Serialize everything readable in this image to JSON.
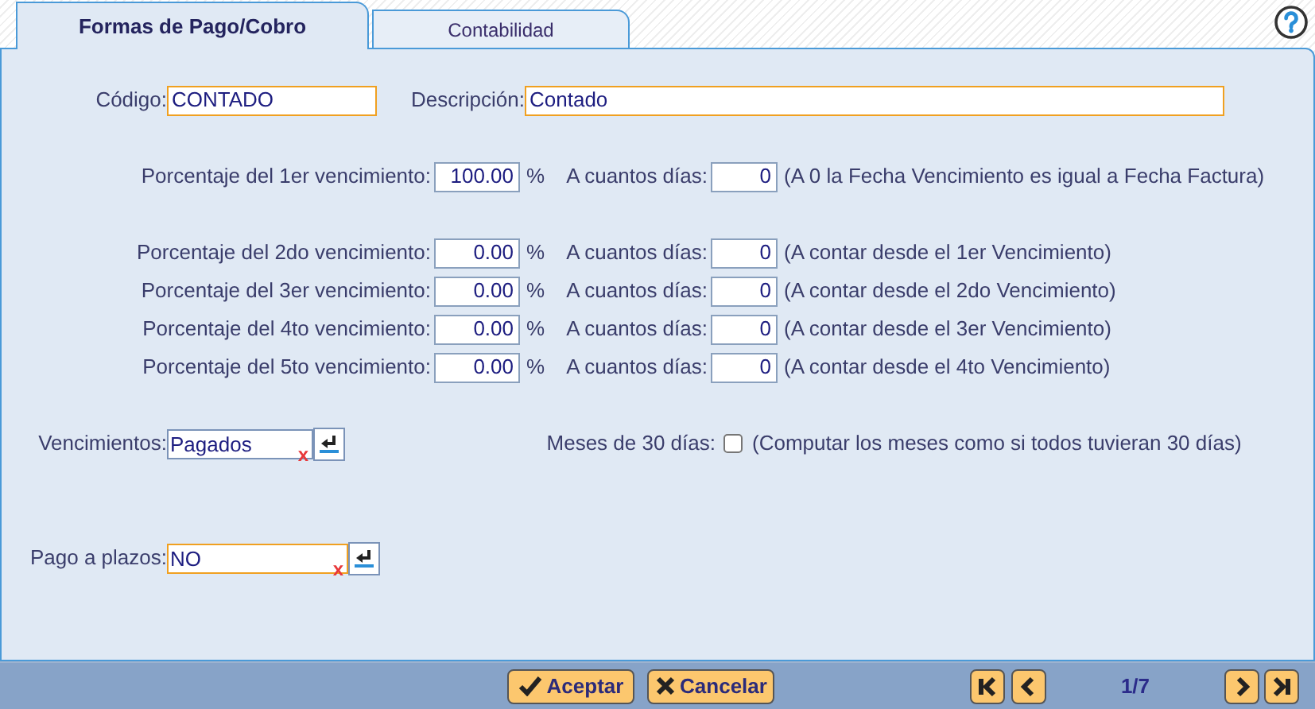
{
  "tabs": [
    {
      "label": "Formas de Pago/Cobro",
      "selected": true
    },
    {
      "label": "Contabilidad",
      "selected": false
    }
  ],
  "header_fields": [
    {
      "label": "Código:",
      "value": "CONTADO",
      "required": true
    },
    {
      "label": "Descripción:",
      "value": "Contado",
      "required": true
    }
  ],
  "first_installment": {
    "label": "Porcentaje del 1er vencimiento:",
    "percent": "100.00",
    "unit": "%",
    "days_label": "A cuantos días:",
    "days": "0",
    "note": "(A 0 la Fecha Vencimiento es igual a Fecha Factura)"
  },
  "installments": [
    {
      "label": "Porcentaje del 2do vencimiento:",
      "percent": "0.00",
      "unit": "%",
      "days_label": "A cuantos días:",
      "days": "0",
      "note": "(A contar desde el 1er Vencimiento)"
    },
    {
      "label": "Porcentaje del 3er vencimiento:",
      "percent": "0.00",
      "unit": "%",
      "days_label": "A cuantos días:",
      "days": "0",
      "note": "(A contar desde el 2do Vencimiento)"
    },
    {
      "label": "Porcentaje del 4to vencimiento:",
      "percent": "0.00",
      "unit": "%",
      "days_label": "A cuantos días:",
      "days": "0",
      "note": "(A contar desde el 3er Vencimiento)"
    },
    {
      "label": "Porcentaje del 5to vencimiento:",
      "percent": "0.00",
      "unit": "%",
      "days_label": "A cuantos días:",
      "days": "0",
      "note": "(A contar desde el 4to Vencimiento)"
    }
  ],
  "vencimientos": {
    "label": "Vencimientos:",
    "value": "Pagados",
    "required": false,
    "clear": "x"
  },
  "months_30": {
    "label": "Meses de 30 días:",
    "checked": false,
    "note": "(Computar los meses como si todos tuvieran 30 días)"
  },
  "pago_a_plazos": {
    "label": "Pago a plazos:",
    "value": "NO",
    "required": true,
    "clear": "x"
  },
  "buttons": [
    {
      "kind": "accept",
      "label": "Aceptar"
    },
    {
      "kind": "cancel",
      "label": "Cancelar"
    }
  ],
  "pager": {
    "position": "1/7"
  }
}
